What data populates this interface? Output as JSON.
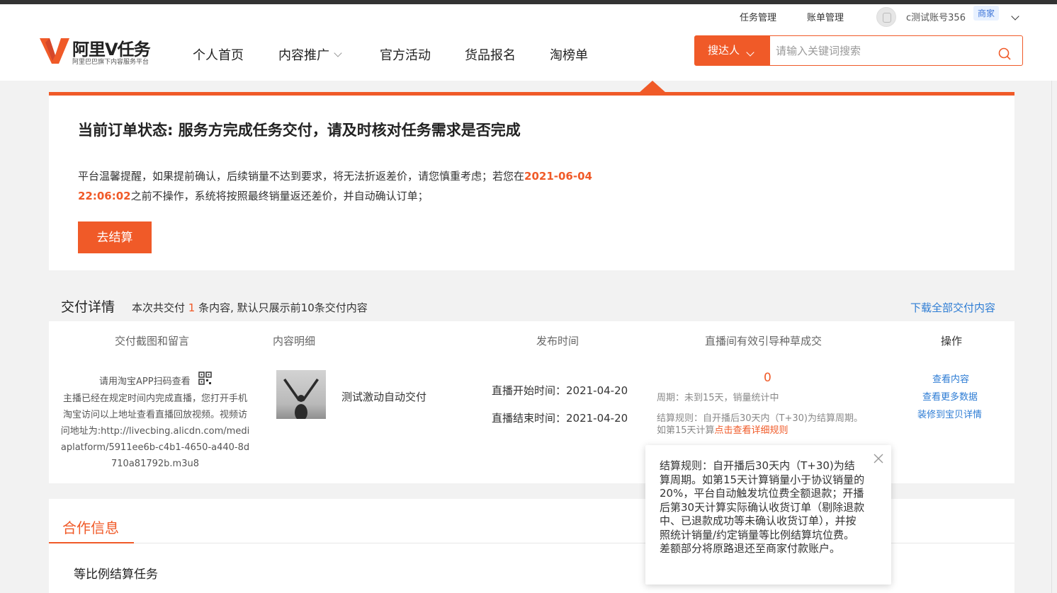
{
  "header": {
    "util_links": [
      "任务管理",
      "账单管理"
    ],
    "account_name": "c测试账号356",
    "account_badge": "商家",
    "logo_title": "阿里V任务",
    "logo_subtitle": "阿里巴巴旗下内容服务平台",
    "nav": [
      "个人首页",
      "内容推广",
      "官方活动",
      "货品报名",
      "淘榜单"
    ],
    "search": {
      "type_label": "搜达人",
      "placeholder": "请输入关键词搜索"
    }
  },
  "status": {
    "title": "当前订单状态: 服务方完成任务交付，请及时核对任务需求是否完成",
    "notice_prefix": "平台温馨提醒，如果提前确认，后续销量不达到要求，将无法折返差价，请您慎重考虑；若您在",
    "deadline": "2021-06-04 22:06:02",
    "notice_suffix": "之前不操作，系统将按照最终销量返还差价，并自动确认订单；",
    "settle_button": "去结算"
  },
  "delivery": {
    "title": "交付详情",
    "subtitle_prefix": "本次共交付",
    "count": "1",
    "subtitle_suffix": "条内容, 默认只展示前10条交付内容",
    "download_link": "下载全部交付内容",
    "columns": [
      "交付截图和留言",
      "内容明细",
      "发布时间",
      "直播间有效引导种草成交",
      "操作"
    ],
    "row": {
      "qr_hint": "请用淘宝APP扫码查看",
      "note": "主播已经在规定时间内完成直播，您打开手机淘宝访问以上地址查看直播回放视频。视频访问地址为:http://livecbing.alicdn.com/mediaplatform/5911ee6b-c4b1-4650-a440-8d710a81792b.m3u8",
      "content_title": "测试激动自动交付",
      "start_time": "直播开始时间：2021-04-20",
      "end_time": "直播结束时间：2021-04-20",
      "effective_value": "0",
      "period": "周期：未到15天，销量统计中",
      "rule_line1": "结算规则：自开播后30天内（T+30)为结算周期。",
      "rule_line2_prefix": "如第15天计算",
      "rule_link": "点击查看详细规则",
      "actions": [
        "查看内容",
        "查看更多数据",
        "装修到宝贝详情"
      ]
    }
  },
  "cooperation": {
    "tab": "合作信息",
    "item": "等比例结算任务"
  },
  "popover": {
    "text": "结算规则：自开播后30天内（T+30)为结算周期。如第15天计算销量小于协议销量的20%，平台自动触发坑位费全额退款；开播后第30天计算实际确认收货订单（剔除退款中、已退款成功等未确认收货订单），并按照统计销量/约定销量等比例结算坑位费。差额部分将原路退还至商家付款账户。"
  },
  "colors": {
    "accent": "#f05a28",
    "link": "#2d7cd4"
  }
}
